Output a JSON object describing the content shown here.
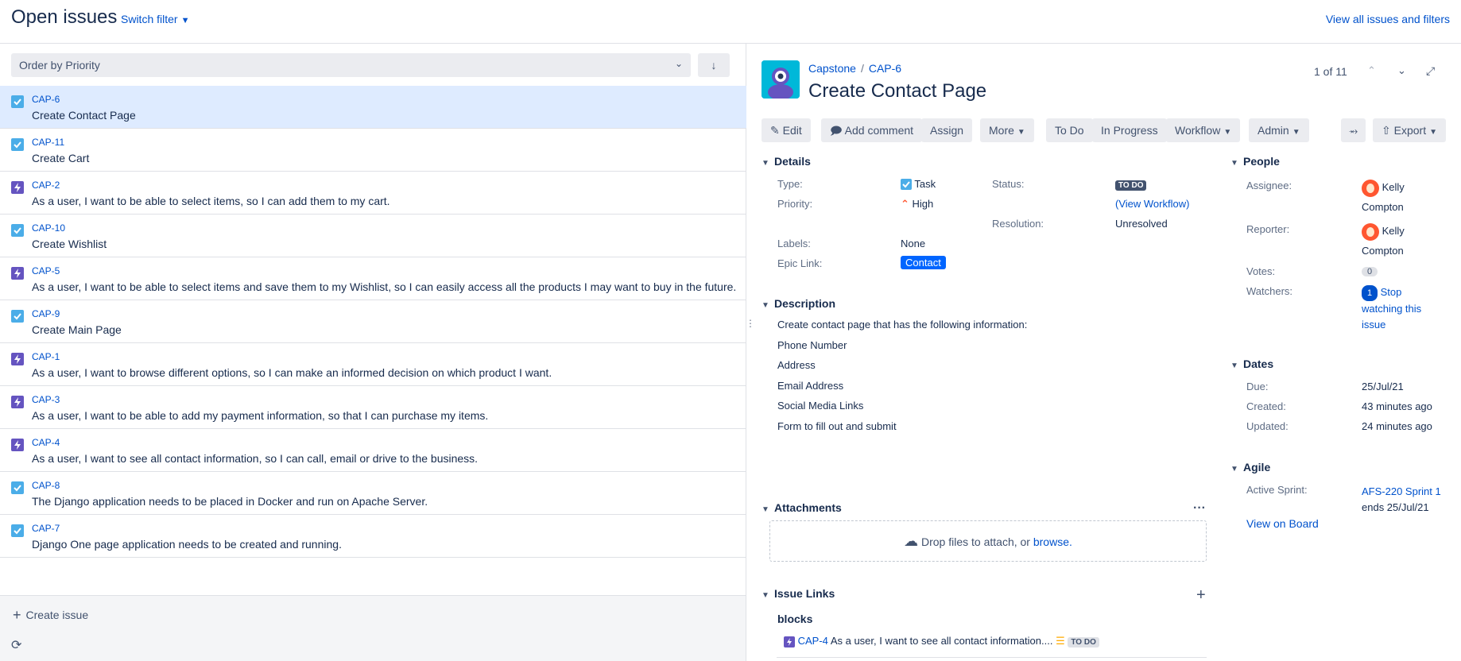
{
  "header": {
    "title": "Open issues",
    "switch_filter": "Switch filter",
    "view_all": "View all issues and filters"
  },
  "left": {
    "order_label": "Order by Priority",
    "create_issue": "Create issue",
    "issues": [
      {
        "key": "CAP-6",
        "summary": "Create Contact Page",
        "type": "task"
      },
      {
        "key": "CAP-11",
        "summary": "Create Cart",
        "type": "task"
      },
      {
        "key": "CAP-2",
        "summary": "As a user, I want to be able to select items, so I can add them to my cart.",
        "type": "story"
      },
      {
        "key": "CAP-10",
        "summary": "Create Wishlist",
        "type": "task"
      },
      {
        "key": "CAP-5",
        "summary": "As a user, I want to be able to select items and save them to my Wishlist, so I can easily access all the products I may want to buy in the future.",
        "type": "story"
      },
      {
        "key": "CAP-9",
        "summary": "Create Main Page",
        "type": "task"
      },
      {
        "key": "CAP-1",
        "summary": "As a user, I want to browse different options, so I can make an informed decision on which product I want.",
        "type": "story"
      },
      {
        "key": "CAP-3",
        "summary": "As a user, I want to be able to add my payment information, so that I can purchase my items.",
        "type": "story"
      },
      {
        "key": "CAP-4",
        "summary": "As a user, I want to see all contact information, so I can call, email or drive to the business.",
        "type": "story"
      },
      {
        "key": "CAP-8",
        "summary": "The Django application needs to be placed in Docker and run on Apache Server.",
        "type": "task"
      },
      {
        "key": "CAP-7",
        "summary": "Django One page application needs to be created and running.",
        "type": "task"
      }
    ]
  },
  "issue": {
    "project": "Capstone",
    "key": "CAP-6",
    "title": "Create Contact Page",
    "pager": "1 of 11",
    "toolbar": {
      "edit": "Edit",
      "add_comment": "Add comment",
      "assign": "Assign",
      "more": "More",
      "todo": "To Do",
      "in_progress": "In Progress",
      "workflow": "Workflow",
      "admin": "Admin",
      "export": "Export"
    },
    "details": {
      "heading": "Details",
      "type_label": "Type:",
      "type_value": "Task",
      "priority_label": "Priority:",
      "priority_value": "High",
      "labels_label": "Labels:",
      "labels_value": "None",
      "epic_label": "Epic Link:",
      "epic_value": "Contact",
      "status_label": "Status:",
      "status_value": "TO DO",
      "view_workflow": "View Workflow",
      "resolution_label": "Resolution:",
      "resolution_value": "Unresolved"
    },
    "description": {
      "heading": "Description",
      "lines": [
        "Create contact page that has the following information:",
        "Phone Number",
        "Address",
        "Email Address",
        "Social Media Links",
        "Form to fill out and submit"
      ]
    },
    "attachments": {
      "heading": "Attachments",
      "drop_text": "Drop files to attach, or ",
      "browse": "browse."
    },
    "links": {
      "heading": "Issue Links",
      "relation": "blocks",
      "linked_key": "CAP-4",
      "linked_summary": "As a user, I want to see all contact information....",
      "linked_status": "TO DO"
    },
    "people": {
      "heading": "People",
      "assignee_label": "Assignee:",
      "assignee_first": "Kelly",
      "assignee_last": "Compton",
      "reporter_label": "Reporter:",
      "reporter_first": "Kelly",
      "reporter_last": "Compton",
      "votes_label": "Votes:",
      "votes": "0",
      "watchers_label": "Watchers:",
      "watchers": "1",
      "stop_watching_1": "Stop",
      "stop_watching_2": "watching this",
      "stop_watching_3": "issue"
    },
    "dates": {
      "heading": "Dates",
      "due_label": "Due:",
      "due": "25/Jul/21",
      "created_label": "Created:",
      "created": "43 minutes ago",
      "updated_label": "Updated:",
      "updated": "24 minutes ago"
    },
    "agile": {
      "heading": "Agile",
      "sprint_label": "Active Sprint:",
      "sprint": "AFS-220 Sprint 1",
      "sprint_ends": "ends 25/Jul/21",
      "view_board": "View on Board"
    }
  },
  "colors": {
    "link": "#0052cc",
    "selected_row": "#deebff",
    "task_icon": "#4bade8",
    "story_icon": "#6554c0",
    "priority_high": "#ff5630",
    "epic": "#0065ff"
  }
}
